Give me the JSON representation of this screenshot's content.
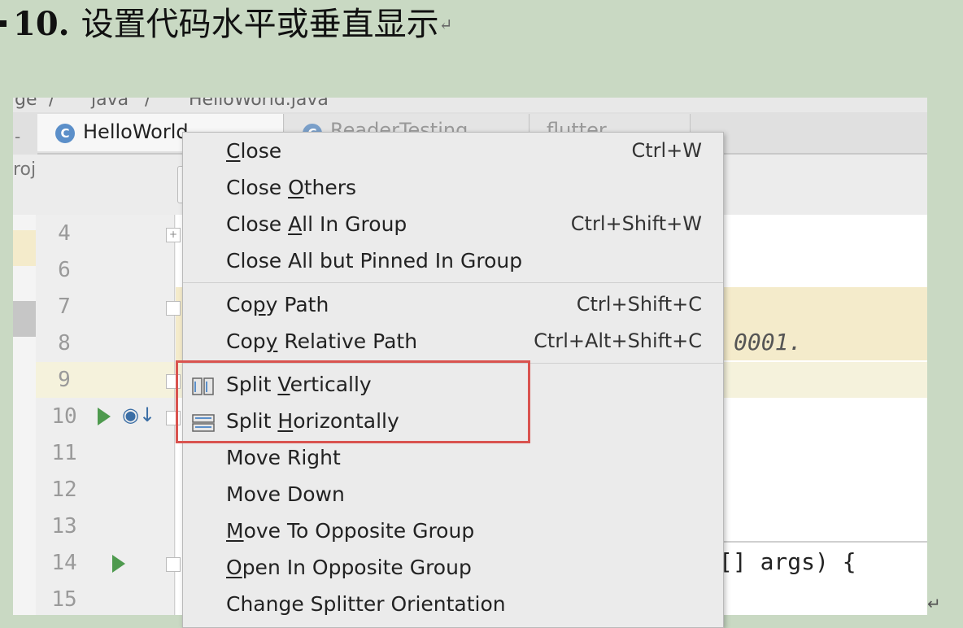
{
  "heading": {
    "number": "10.",
    "text": "设置代码水平或垂直显示",
    "return_mark": "↵"
  },
  "breadcrumbs": [
    "ge",
    "java",
    "HelloWorld.java"
  ],
  "tabs": [
    {
      "label": "HelloWorld...",
      "icon": "class-c-icon",
      "active": true
    },
    {
      "label": "ReaderTesting...",
      "icon": "class-c-icon",
      "active": false
    },
    {
      "label": "flutter...",
      "icon": "file-icon",
      "active": false
    }
  ],
  "left_strip": {
    "tab_edge": "-",
    "project_fragment": "roj"
  },
  "line_numbers": [
    "4",
    "6",
    "7",
    "8",
    "9",
    "10",
    "11",
    "12",
    "13",
    "14",
    "15"
  ],
  "code_fragments": {
    "line8_tail": "0001.",
    "line14_tail": "[] args) {"
  },
  "menu": {
    "group1": [
      {
        "pre": "",
        "ul": "C",
        "post": "lose",
        "shortcut": "Ctrl+W"
      },
      {
        "pre": "Close ",
        "ul": "O",
        "post": "thers",
        "shortcut": ""
      },
      {
        "pre": "Close ",
        "ul": "A",
        "post": "ll In Group",
        "shortcut": "Ctrl+Shift+W"
      },
      {
        "pre": "Close All but Pinned In Group",
        "ul": "",
        "post": "",
        "shortcut": ""
      }
    ],
    "group2": [
      {
        "pre": "Co",
        "ul": "p",
        "post": "y Path",
        "shortcut": "Ctrl+Shift+C"
      },
      {
        "pre": "Cop",
        "ul": "y",
        "post": " Relative Path",
        "shortcut": "Ctrl+Alt+Shift+C"
      }
    ],
    "group3": [
      {
        "pre": "Split ",
        "ul": "V",
        "post": "ertically",
        "shortcut": "",
        "icon": "split-vertical-icon"
      },
      {
        "pre": "Split ",
        "ul": "H",
        "post": "orizontally",
        "shortcut": "",
        "icon": "split-horizontal-icon"
      },
      {
        "pre": "Move Right",
        "ul": "",
        "post": "",
        "shortcut": ""
      },
      {
        "pre": "Move Down",
        "ul": "",
        "post": "",
        "shortcut": ""
      },
      {
        "pre": "",
        "ul": "M",
        "post": "ove To Opposite Group",
        "shortcut": ""
      },
      {
        "pre": "",
        "ul": "O",
        "post": "pen In Opposite Group",
        "shortcut": ""
      },
      {
        "pre": "Change Splitter Orientation",
        "ul": "",
        "post": "",
        "shortcut": ""
      }
    ]
  },
  "colors": {
    "highlight_box": "#d9534f",
    "slide_bg": "#c9d9c3",
    "run_icon": "#4e9a4e"
  }
}
